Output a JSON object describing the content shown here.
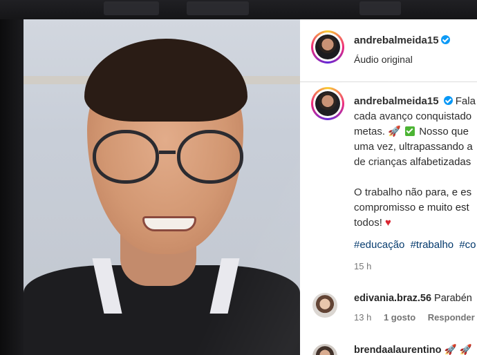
{
  "post": {
    "author": "andrebalmeida15",
    "audio_label": "Áudio original",
    "caption_lines": [
      "Fala",
      "cada avanço conquistado",
      "metas. 🚀",
      "Nosso que",
      "uma vez, ultrapassando a",
      "de crianças alfabetizadas",
      "O trabalho não para, e es",
      "compromisso e muito est",
      "todos!"
    ],
    "hashtags": [
      "#educação",
      "#trabalho",
      "#co"
    ],
    "time": "15 h"
  },
  "comments": [
    {
      "username": "edivania.braz.56",
      "text": "Parabén",
      "time": "13 h",
      "likes": "1 gosto",
      "reply": "Responder"
    },
    {
      "username": "brendaalaurentino",
      "text": "🚀 🚀"
    }
  ],
  "colors": {
    "verified": "#0095f6",
    "hashtag": "#00376b",
    "meta": "#737373",
    "heart": "#d81e2b"
  },
  "icons": [
    "verified-badge-icon",
    "check-emoji-icon",
    "heart-emoji-icon",
    "rocket-emoji-icon"
  ]
}
